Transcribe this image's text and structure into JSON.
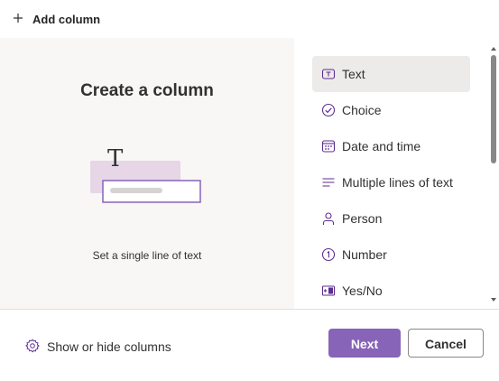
{
  "header": {
    "add_column_label": "Add column",
    "icon": "plus-icon"
  },
  "preview": {
    "title": "Create a column",
    "description": "Set a single line of text"
  },
  "column_types": [
    {
      "label": "Text",
      "icon": "text-box-icon",
      "selected": true
    },
    {
      "label": "Choice",
      "icon": "circle-check-icon",
      "selected": false
    },
    {
      "label": "Date and time",
      "icon": "calendar-icon",
      "selected": false
    },
    {
      "label": "Multiple lines of text",
      "icon": "text-lines-icon",
      "selected": false
    },
    {
      "label": "Person",
      "icon": "person-icon",
      "selected": false
    },
    {
      "label": "Number",
      "icon": "number-one-icon",
      "selected": false
    },
    {
      "label": "Yes/No",
      "icon": "toggle-icon",
      "selected": false
    }
  ],
  "footer": {
    "show_hide_label": "Show or hide columns",
    "next_label": "Next",
    "cancel_label": "Cancel"
  },
  "colors": {
    "accent": "#8764b8",
    "selected_bg": "#edebe9",
    "preview_bg": "#f8f7f5"
  }
}
